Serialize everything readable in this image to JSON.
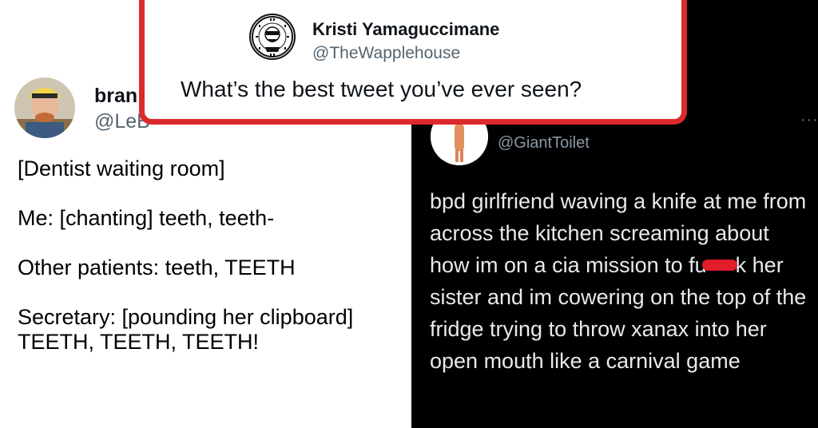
{
  "overlay_tweet": {
    "name": "Kristi Yamaguccimane",
    "handle": "@TheWapplehouse",
    "text": "What’s the best tweet you’ve ever seen?",
    "border_color": "#dc2a2c",
    "avatar_icon": "waffle-house-badge-icon"
  },
  "left_tweet": {
    "name": "bran",
    "handle": "@LeB",
    "avatar_icon": "person-eating-avatar-icon",
    "lines": [
      "[Dentist waiting room]",
      "Me: [chanting] teeth, teeth-",
      "Other patients: teeth, TEETH",
      "Secretary: [pounding her clipboard]\nTEETH, TEETH, TEETH!"
    ]
  },
  "right_tweet": {
    "handle": "@GiantToilet",
    "more_icon": "more-dots-icon",
    "avatar_icon": "orange-figure-avatar-icon",
    "text_before_redaction": "bpd girlfriend waving a knife at me from across the kitchen screaming about how im on a cia mission to fu",
    "redaction_color": "#e11d2a",
    "text_after_redaction": "k her sister and im cowering on the top of the fridge trying to throw xanax into her open mouth like a carnival game"
  }
}
